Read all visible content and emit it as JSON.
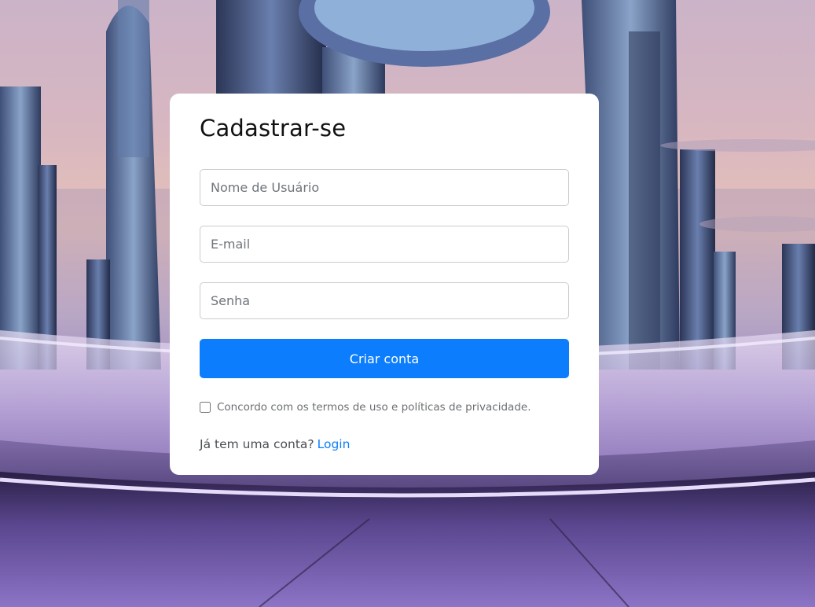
{
  "form": {
    "title": "Cadastrar-se",
    "username_placeholder": "Nome de Usuário",
    "email_placeholder": "E-mail",
    "password_placeholder": "Senha",
    "submit_label": "Criar conta",
    "terms_label": "Concordo com os termos de uso e políticas de privacidade.",
    "terms_checked": false,
    "login_prompt": "Já tem uma conta?",
    "login_link": "Login"
  },
  "colors": {
    "primary": "#0b7dfd",
    "card_background": "#ffffff"
  }
}
